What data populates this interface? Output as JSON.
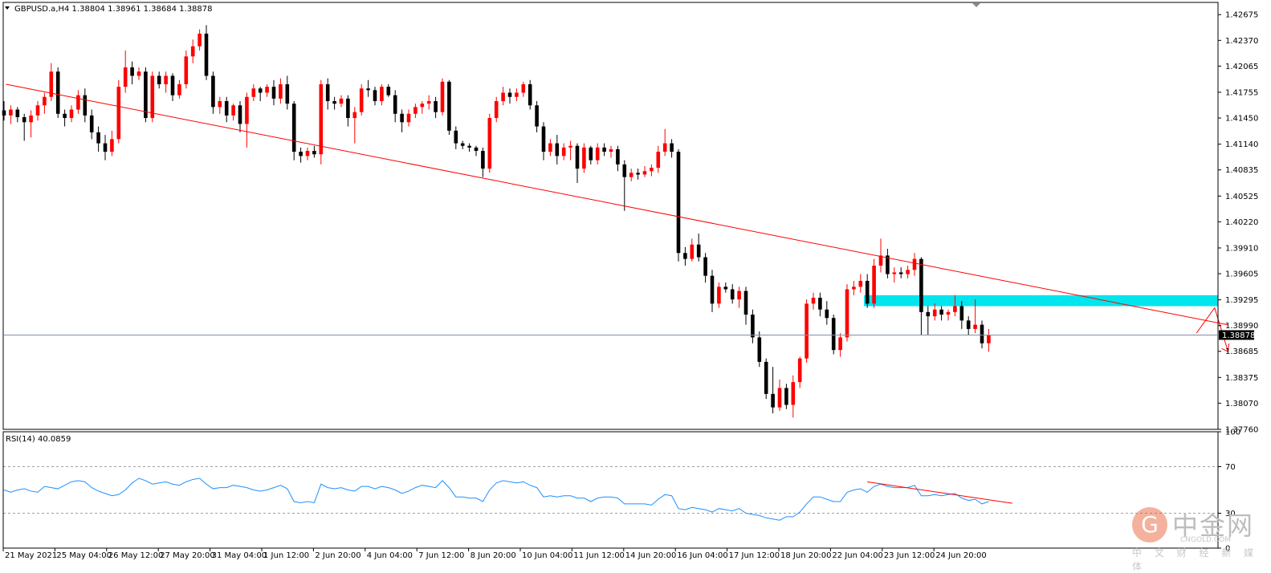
{
  "header": {
    "symbol_info": "GBPUSD.a,H4  1.38804 1.38961 1.38684 1.38878"
  },
  "rsi_header": "RSI(14) 40.0859",
  "current_price_label": "1.38878",
  "watermark": {
    "name": "中金网",
    "url": "CNGOLD.COM",
    "subtitle": "中 文 财 经 新 媒 体"
  },
  "colors": {
    "bull": "#ff0000",
    "bear": "#000000",
    "trendline": "#ff0000",
    "zone": "#00e5ee",
    "rsi": "#1e90ff",
    "price_line": "#7f8fa6"
  },
  "chart_data": [
    {
      "type": "candlestick",
      "title": "GBPUSD.a,H4",
      "ylim": [
        1.3776,
        1.4282
      ],
      "y_ticks": [
        "1.42675",
        "1.42370",
        "1.42065",
        "1.41755",
        "1.41450",
        "1.41140",
        "1.40835",
        "1.40525",
        "1.40220",
        "1.39910",
        "1.39605",
        "1.39295",
        "1.38990",
        "1.38685",
        "1.38375",
        "1.38070",
        "1.37760"
      ],
      "x_tick_labels": [
        "21 May 2021",
        "25 May 04:00",
        "26 May 12:00",
        "27 May 20:00",
        "31 May 04:00",
        "1 Jun 12:00",
        "2 Jun 20:00",
        "4 Jun 04:00",
        "7 Jun 12:00",
        "8 Jun 20:00",
        "10 Jun 04:00",
        "11 Jun 12:00",
        "14 Jun 20:00",
        "16 Jun 04:00",
        "17 Jun 12:00",
        "18 Jun 20:00",
        "22 Jun 04:00",
        "23 Jun 12:00",
        "24 Jun 20:00"
      ],
      "last_price": 1.38878,
      "trendline": {
        "from": [
          0.3,
          1.4185
        ],
        "to": [
          181.4,
          1.39
        ]
      },
      "zone": {
        "x": [
          127.5,
          180.0
        ],
        "y": [
          1.3922,
          1.3935
        ]
      },
      "projection_arrow": [
        [
          176.8,
          1.389
        ],
        [
          179.5,
          1.392
        ],
        [
          181.5,
          1.3868
        ]
      ],
      "candles": [
        [
          1.4154,
          1.4165,
          1.4142,
          1.4148
        ],
        [
          1.4148,
          1.416,
          1.4138,
          1.4155
        ],
        [
          1.4155,
          1.4158,
          1.414,
          1.4146
        ],
        [
          1.4146,
          1.415,
          1.4118,
          1.414
        ],
        [
          1.414,
          1.4154,
          1.4122,
          1.4148
        ],
        [
          1.4148,
          1.4165,
          1.4142,
          1.416
        ],
        [
          1.416,
          1.4175,
          1.415,
          1.417
        ],
        [
          1.417,
          1.421,
          1.4165,
          1.42
        ],
        [
          1.42,
          1.4205,
          1.4145,
          1.415
        ],
        [
          1.415,
          1.4155,
          1.4135,
          1.4145
        ],
        [
          1.4145,
          1.416,
          1.414,
          1.4155
        ],
        [
          1.4155,
          1.4178,
          1.415,
          1.4172
        ],
        [
          1.4172,
          1.418,
          1.414,
          1.4148
        ],
        [
          1.4148,
          1.4155,
          1.412,
          1.4128
        ],
        [
          1.4128,
          1.4135,
          1.4105,
          1.4115
        ],
        [
          1.4115,
          1.4125,
          1.4095,
          1.4105
        ],
        [
          1.4105,
          1.413,
          1.41,
          1.412
        ],
        [
          1.412,
          1.419,
          1.4115,
          1.4182
        ],
        [
          1.4182,
          1.4225,
          1.4175,
          1.4205
        ],
        [
          1.4205,
          1.4212,
          1.4185,
          1.4195
        ],
        [
          1.4195,
          1.4205,
          1.419,
          1.42
        ],
        [
          1.42,
          1.4205,
          1.414,
          1.4145
        ],
        [
          1.4145,
          1.42,
          1.414,
          1.4195
        ],
        [
          1.4195,
          1.42,
          1.418,
          1.4185
        ],
        [
          1.4185,
          1.42,
          1.4175,
          1.4195
        ],
        [
          1.4195,
          1.4198,
          1.4165,
          1.4172
        ],
        [
          1.4172,
          1.419,
          1.4168,
          1.4185
        ],
        [
          1.4185,
          1.4225,
          1.418,
          1.4218
        ],
        [
          1.4218,
          1.4238,
          1.421,
          1.423
        ],
        [
          1.423,
          1.425,
          1.4225,
          1.4245
        ],
        [
          1.4245,
          1.4255,
          1.419,
          1.4195
        ],
        [
          1.4195,
          1.42,
          1.415,
          1.4158
        ],
        [
          1.4158,
          1.417,
          1.415,
          1.4165
        ],
        [
          1.4165,
          1.417,
          1.414,
          1.4148
        ],
        [
          1.4148,
          1.4162,
          1.4142,
          1.416
        ],
        [
          1.416,
          1.4165,
          1.4128,
          1.4138
        ],
        [
          1.4138,
          1.4175,
          1.411,
          1.417
        ],
        [
          1.417,
          1.4185,
          1.4165,
          1.418
        ],
        [
          1.418,
          1.4182,
          1.4165,
          1.4175
        ],
        [
          1.4175,
          1.4185,
          1.417,
          1.4182
        ],
        [
          1.4182,
          1.419,
          1.416,
          1.4168
        ],
        [
          1.4168,
          1.4192,
          1.4162,
          1.4185
        ],
        [
          1.4185,
          1.4195,
          1.4155,
          1.4162
        ],
        [
          1.4162,
          1.4165,
          1.4095,
          1.4105
        ],
        [
          1.4105,
          1.411,
          1.4092,
          1.41
        ],
        [
          1.41,
          1.411,
          1.4095,
          1.4106
        ],
        [
          1.4106,
          1.4112,
          1.4098,
          1.4102
        ],
        [
          1.4102,
          1.419,
          1.409,
          1.4185
        ],
        [
          1.4185,
          1.4192,
          1.4155,
          1.4165
        ],
        [
          1.4165,
          1.417,
          1.4155,
          1.4162
        ],
        [
          1.4162,
          1.4172,
          1.4158,
          1.4168
        ],
        [
          1.4168,
          1.4172,
          1.4135,
          1.4145
        ],
        [
          1.4145,
          1.4158,
          1.4115,
          1.4152
        ],
        [
          1.4152,
          1.4185,
          1.4148,
          1.418
        ],
        [
          1.418,
          1.419,
          1.417,
          1.4178
        ],
        [
          1.4178,
          1.4182,
          1.416,
          1.4165
        ],
        [
          1.4165,
          1.4185,
          1.416,
          1.4182
        ],
        [
          1.4182,
          1.4185,
          1.417,
          1.4172
        ],
        [
          1.4172,
          1.4178,
          1.414,
          1.415
        ],
        [
          1.415,
          1.4155,
          1.4128,
          1.414
        ],
        [
          1.414,
          1.4155,
          1.4135,
          1.415
        ],
        [
          1.415,
          1.4162,
          1.4145,
          1.4158
        ],
        [
          1.4158,
          1.4165,
          1.415,
          1.4162
        ],
        [
          1.4162,
          1.4172,
          1.4155,
          1.4165
        ],
        [
          1.4165,
          1.417,
          1.4145,
          1.4152
        ],
        [
          1.4152,
          1.4192,
          1.4148,
          1.4188
        ],
        [
          1.4188,
          1.419,
          1.4125,
          1.413
        ],
        [
          1.413,
          1.4135,
          1.4108,
          1.4115
        ],
        [
          1.4115,
          1.4118,
          1.4108,
          1.4112
        ],
        [
          1.4112,
          1.4115,
          1.4105,
          1.411
        ],
        [
          1.411,
          1.4112,
          1.41,
          1.4106
        ],
        [
          1.4106,
          1.411,
          1.4075,
          1.4085
        ],
        [
          1.4085,
          1.415,
          1.408,
          1.4145
        ],
        [
          1.4145,
          1.417,
          1.414,
          1.4165
        ],
        [
          1.4165,
          1.4182,
          1.416,
          1.4175
        ],
        [
          1.4175,
          1.418,
          1.4162,
          1.417
        ],
        [
          1.417,
          1.418,
          1.4165,
          1.4175
        ],
        [
          1.4175,
          1.4188,
          1.417,
          1.4185
        ],
        [
          1.4185,
          1.419,
          1.4155,
          1.416
        ],
        [
          1.416,
          1.4165,
          1.4128,
          1.4135
        ],
        [
          1.4135,
          1.414,
          1.4095,
          1.4105
        ],
        [
          1.4105,
          1.412,
          1.41,
          1.4115
        ],
        [
          1.4115,
          1.4125,
          1.409,
          1.41
        ],
        [
          1.41,
          1.4115,
          1.4095,
          1.411
        ],
        [
          1.411,
          1.4118,
          1.4095,
          1.4112
        ],
        [
          1.4112,
          1.4115,
          1.4068,
          1.4085
        ],
        [
          1.4085,
          1.4115,
          1.408,
          1.411
        ],
        [
          1.411,
          1.4112,
          1.409,
          1.4095
        ],
        [
          1.4095,
          1.4115,
          1.409,
          1.411
        ],
        [
          1.411,
          1.4115,
          1.41,
          1.4105
        ],
        [
          1.4105,
          1.4112,
          1.4098,
          1.4108
        ],
        [
          1.4108,
          1.4112,
          1.4082,
          1.409
        ],
        [
          1.409,
          1.4095,
          1.4035,
          1.4075
        ],
        [
          1.4075,
          1.4085,
          1.407,
          1.408
        ],
        [
          1.408,
          1.4085,
          1.4072,
          1.4078
        ],
        [
          1.4078,
          1.4088,
          1.4075,
          1.4082
        ],
        [
          1.4082,
          1.409,
          1.4076,
          1.4086
        ],
        [
          1.4086,
          1.4112,
          1.408,
          1.4105
        ],
        [
          1.4105,
          1.4132,
          1.41,
          1.4115
        ],
        [
          1.4115,
          1.412,
          1.4098,
          1.4105
        ],
        [
          1.4105,
          1.4108,
          1.3975,
          1.3985
        ],
        [
          1.3985,
          1.3992,
          1.397,
          1.3978
        ],
        [
          1.3978,
          1.4002,
          1.3975,
          1.3995
        ],
        [
          1.3995,
          1.4008,
          1.3975,
          1.398
        ],
        [
          1.398,
          1.3985,
          1.395,
          1.3958
        ],
        [
          1.3958,
          1.3965,
          1.3915,
          1.3925
        ],
        [
          1.3925,
          1.395,
          1.392,
          1.3945
        ],
        [
          1.3945,
          1.395,
          1.3938,
          1.3942
        ],
        [
          1.3942,
          1.3948,
          1.3925,
          1.393
        ],
        [
          1.393,
          1.3945,
          1.392,
          1.394
        ],
        [
          1.394,
          1.3945,
          1.39,
          1.3912
        ],
        [
          1.3912,
          1.3918,
          1.3878,
          1.3885
        ],
        [
          1.3885,
          1.3892,
          1.385,
          1.3856
        ],
        [
          1.3856,
          1.386,
          1.3812,
          1.3818
        ],
        [
          1.3818,
          1.385,
          1.3795,
          1.3802
        ],
        [
          1.3802,
          1.3835,
          1.3798,
          1.3825
        ],
        [
          1.3825,
          1.383,
          1.38,
          1.3805
        ],
        [
          1.3805,
          1.384,
          1.379,
          1.3832
        ],
        [
          1.3832,
          1.3862,
          1.3825,
          1.386
        ],
        [
          1.386,
          1.393,
          1.3855,
          1.3925
        ],
        [
          1.3925,
          1.3938,
          1.3918,
          1.3932
        ],
        [
          1.3932,
          1.3938,
          1.391,
          1.3918
        ],
        [
          1.3918,
          1.3928,
          1.39,
          1.3908
        ],
        [
          1.3908,
          1.3912,
          1.3865,
          1.387
        ],
        [
          1.387,
          1.389,
          1.3862,
          1.3885
        ],
        [
          1.3885,
          1.3948,
          1.388,
          1.3942
        ],
        [
          1.3942,
          1.3952,
          1.3935,
          1.3945
        ],
        [
          1.3945,
          1.396,
          1.3938,
          1.3952
        ],
        [
          1.3952,
          1.396,
          1.392,
          1.3925
        ],
        [
          1.3925,
          1.3978,
          1.392,
          1.397
        ],
        [
          1.397,
          1.4002,
          1.3962,
          1.3982
        ],
        [
          1.3982,
          1.399,
          1.3955,
          1.396
        ],
        [
          1.396,
          1.3968,
          1.395,
          1.3962
        ],
        [
          1.3962,
          1.3968,
          1.3955,
          1.396
        ],
        [
          1.396,
          1.397,
          1.3955,
          1.3965
        ],
        [
          1.3965,
          1.3985,
          1.3958,
          1.3978
        ],
        [
          1.3978,
          1.398,
          1.3888,
          1.3915
        ],
        [
          1.3915,
          1.3922,
          1.3888,
          1.391
        ],
        [
          1.391,
          1.3925,
          1.3905,
          1.3918
        ],
        [
          1.3918,
          1.3922,
          1.3905,
          1.3912
        ],
        [
          1.3912,
          1.3918,
          1.3905,
          1.3915
        ],
        [
          1.3915,
          1.3935,
          1.391,
          1.3922
        ],
        [
          1.3922,
          1.3928,
          1.3895,
          1.3905
        ],
        [
          1.3905,
          1.391,
          1.3888,
          1.3895
        ],
        [
          1.3895,
          1.393,
          1.389,
          1.39
        ],
        [
          1.39,
          1.3905,
          1.3872,
          1.3878
        ],
        [
          1.3878,
          1.3895,
          1.3868,
          1.3888
        ]
      ]
    },
    {
      "type": "line",
      "title": "RSI(14)",
      "current_value": 40.0859,
      "ylim": [
        0,
        100
      ],
      "y_ticks": [
        100,
        70,
        30,
        0
      ],
      "levels": [
        70,
        30
      ],
      "series": [
        {
          "values": [
            50,
            48,
            50,
            51,
            49,
            48,
            53,
            52,
            51,
            54,
            57,
            58,
            57,
            52,
            49,
            47,
            45,
            46,
            50,
            56,
            60,
            58,
            55,
            56,
            57,
            55,
            54,
            57,
            59,
            60,
            55,
            51,
            52,
            52,
            54,
            53,
            52,
            50,
            49,
            50,
            52,
            54,
            51,
            40,
            39,
            40,
            39,
            55,
            52,
            51,
            52,
            50,
            49,
            53,
            53,
            51,
            53,
            52,
            50,
            47,
            49,
            52,
            54,
            53,
            52,
            58,
            52,
            44,
            44,
            43,
            43,
            40,
            50,
            56,
            58,
            57,
            56,
            57,
            54,
            52,
            44,
            45,
            44,
            45,
            45,
            43,
            43,
            40,
            43,
            44,
            44,
            43,
            38,
            38,
            38,
            38,
            37,
            42,
            46,
            45,
            34,
            33,
            35,
            34,
            33,
            31,
            34,
            33,
            32,
            34,
            30,
            29,
            28,
            26,
            25,
            24,
            27,
            27,
            31,
            38,
            44,
            44,
            42,
            40,
            40,
            48,
            50,
            51,
            48,
            53,
            55,
            53,
            52,
            52,
            52,
            54,
            45,
            45,
            46,
            45,
            46,
            47,
            43,
            41,
            42,
            38,
            40
          ]
        }
      ]
    }
  ]
}
